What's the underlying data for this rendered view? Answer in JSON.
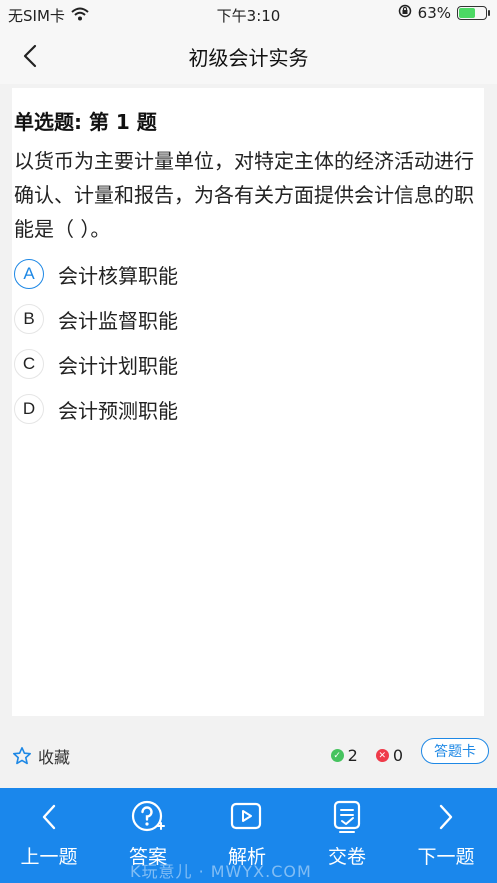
{
  "status_bar": {
    "carrier": "无SIM卡",
    "time": "下午3:10",
    "battery": "63%",
    "battery_level": 0.63
  },
  "nav": {
    "title": "初级会计实务"
  },
  "question": {
    "type_label": "单选题: 第 1 题",
    "text": "以货币为主要计量单位，对特定主体的经济活动进行确认、计量和报告，为各有关方面提供会计信息的职能是（    ）。",
    "options": [
      {
        "letter": "A",
        "text": "会计核算职能",
        "selected": true
      },
      {
        "letter": "B",
        "text": "会计监督职能",
        "selected": false
      },
      {
        "letter": "C",
        "text": "会计计划职能",
        "selected": false
      },
      {
        "letter": "D",
        "text": "会计预测职能",
        "selected": false
      }
    ]
  },
  "toolbar": {
    "favorite_label": "收藏",
    "correct_count": "2",
    "wrong_count": "0",
    "answer_card_label": "答题卡"
  },
  "bottom_nav": {
    "prev_label": "上一题",
    "answer_label": "答案",
    "analysis_label": "解析",
    "submit_label": "交卷",
    "next_label": "下一题"
  },
  "watermark": "K玩意儿 · MWYX.COM",
  "colors": {
    "accent": "#1a87ec",
    "correct": "#46c35f",
    "wrong": "#ef3b4a"
  }
}
